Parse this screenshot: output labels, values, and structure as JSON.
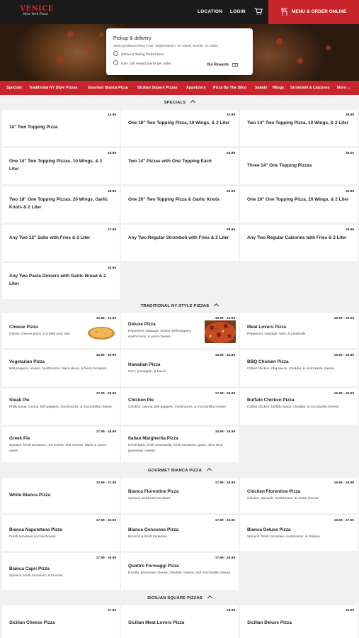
{
  "header": {
    "logo_main": "VENICE",
    "logo_sub": "New York Pizza",
    "location_label": "LOCATION",
    "login_label": "LOGIN",
    "menu_button_label": "MENU & ORDER ONLINE"
  },
  "pickup": {
    "title": "Pickup & delivery",
    "address": "2029 Lynnhaven Pkwy #750, Virginia Beach, VA 23456, Norfolk, VA 23503",
    "status": "Online & Taking Orders Now",
    "points": "Earn 100 reward points per order",
    "rewards_label": "Our Rewards"
  },
  "categories": [
    "Specials",
    "Traditional NY Style Pizzas",
    "Gourmet Bianca Pizza",
    "Sicilian Square Pizzas",
    "Appetizers",
    "Pizza By The Slice",
    "Salads",
    "Wings",
    "Stromboli & Calzones",
    "More"
  ],
  "sections": {
    "specials": {
      "title": "SPECIALS",
      "items": [
        {
          "name": "14\" Two Topping Pizza",
          "price": "14.99"
        },
        {
          "name": "One 18\" Two Topping Pizza, 10 Wings, & 2 Liter",
          "price": "32.99"
        },
        {
          "name": "Two 14\" Two Topping Pizza, 10 Wings, & 2 Liter",
          "price": "39.99"
        },
        {
          "name": "One 14\" Two Topping Pizzas, 10 Wings, & 2 Liter",
          "price": "26.99"
        },
        {
          "name": "Two 14\" Pizzas with One Topping Each",
          "price": "26.99"
        },
        {
          "name": "Three 14\" One Topping Pizzas",
          "price": "39.00"
        },
        {
          "name": "Two 18\" One Topping Pizzas, 20 Wings, Garlic Knots & 2 Liter",
          "price": "58.99"
        },
        {
          "name": "One 20\" Two Topping Pizza & Garlic Knots",
          "price": "25.99"
        },
        {
          "name": "One 20\" One Topping Pizza, 20 Wings, & 2 Liter",
          "price": "45.89"
        },
        {
          "name": "Any Two 12\" Subs with Fries & 2 Liter",
          "price": "27.99"
        },
        {
          "name": "Any Two Regular Stromboli with Fries & 2 Liter",
          "price": "28.99"
        },
        {
          "name": "Any Two Regular Calzones with Fries & 2 Liter",
          "price": "28.99"
        },
        {
          "name": "Any Two Pasta Dinners with Garlic Bread & 2 Liter",
          "price": "30.99"
        }
      ]
    },
    "traditional": {
      "title": "TRADITIONAL NY STYLE PIZZAS",
      "items": [
        {
          "name": "Cheese Pizza",
          "price": "12.99 - 21.99",
          "desc": "Classic cheese pizza or create your own"
        },
        {
          "name": "Deluxe Pizza",
          "price": "16.99 - 25.99",
          "desc": "Pepperoni, sausage, onions, bell peppers, mushrooms, & extra cheese"
        },
        {
          "name": "Meat Lovers Pizza",
          "price": "16.99 - 25.99",
          "desc": "Pepperoni, sausage, ham, & meatballs"
        },
        {
          "name": "Vegetarian Pizza",
          "price": "16.99 - 25.99",
          "desc": "Bell peppers, onions, mushrooms, black olives, & fresh tomatoes"
        },
        {
          "name": "Hawaiian Pizza",
          "price": "15.99 - 24.99",
          "desc": "Ham, pineapple, & bacon"
        },
        {
          "name": "BBQ Chicken Pizza",
          "price": "16.99 - 25.99",
          "desc": "Grilled chicken, bbq sauce, cheddar, & mozzarella cheese"
        },
        {
          "name": "Steak Pie",
          "price": "17.99 - 25.99",
          "desc": "Philly steak, onions, bell peppers, mushrooms, & mozzarella cheese"
        },
        {
          "name": "Chicken Pie",
          "price": "17.99 - 25.99",
          "desc": "Chicken, onions, bell peppers, mushrooms, & mozzarella cheese"
        },
        {
          "name": "Buffalo Chicken Pizza",
          "price": "16.99 - 25.99",
          "desc": "Grilled chicken, buffalo sauce, cheddar, & mozzarella cheese"
        },
        {
          "name": "Greek Pie",
          "price": "17.99 - 26.99",
          "desc": "Spinach, fresh tomatoes, red onions, feta cheese, black or green olives"
        },
        {
          "name": "Italian Margherita Pizza",
          "price": "16.99 - 26.99",
          "desc": "Fresh basil, fresh mozzarella, fresh tomatoes, garlic, olive oil & parmesan cheese"
        }
      ]
    },
    "gourmet": {
      "title": "GOURMET BIANCA PIZZA",
      "items": [
        {
          "name": "White Bianca Pizza",
          "price": "13.99 - 21.99",
          "desc": ""
        },
        {
          "name": "Bianca Florentine Pizza",
          "price": "17.99 - 26.99",
          "desc": "Spinach and fresh tomatoes"
        },
        {
          "name": "Chicken Florentine Pizza",
          "price": "18.99 - 26.99",
          "desc": "Chicken, spinach, mushrooms, & ricotta cheese"
        },
        {
          "name": "Bianca Napoletana Pizza",
          "price": "17.99 - 26.99",
          "desc": "Fresh tomatoes and anchovies"
        },
        {
          "name": "Bianca Genovese Pizza",
          "price": "17.99 - 26.99",
          "desc": "Broccoli & fresh tomatoes"
        },
        {
          "name": "Bianca Deluxe Pizza",
          "price": "18.99 - 27.99",
          "desc": "Spinach, fresh tomatoes, mushrooms, & chicken"
        },
        {
          "name": "Bianca Capri Pizza",
          "price": "17.99 - 26.99",
          "desc": "Spinach, fresh tomatoes, & broccoli"
        },
        {
          "name": "Quattro Formaggi Pizza",
          "price": "17.99 - 26.99",
          "desc": "Ricotta, parmesan cheese, cheddar cheese, and mozzarella cheese"
        }
      ]
    },
    "sicilian": {
      "title": "SICILIAN SQUARE PIZZAS",
      "items": [
        {
          "name": "Sicilian Cheese Pizza",
          "price": "27.99"
        },
        {
          "name": "Sicilian Meat Lovers Pizza",
          "price": "29.99"
        },
        {
          "name": "Sicilian Deluxe Pizza",
          "price": "29.99"
        }
      ]
    }
  },
  "colors": {
    "brand_red": "#c8242b",
    "header_dark": "#1a1a1a"
  }
}
